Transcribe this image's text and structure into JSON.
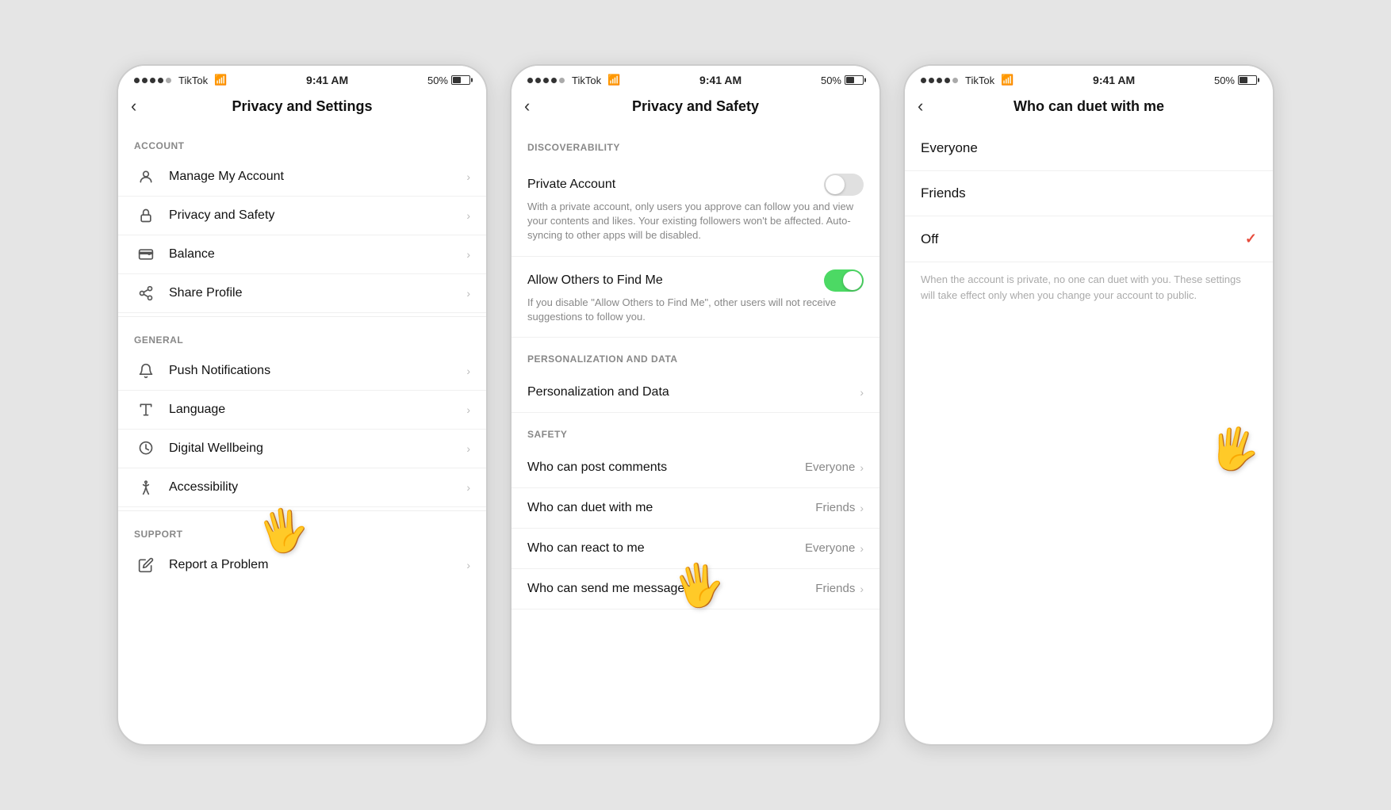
{
  "screens": [
    {
      "id": "privacy-settings",
      "statusBar": {
        "dots": [
          "full",
          "full",
          "full",
          "full",
          "full"
        ],
        "carrier": "TikTok",
        "wifi": true,
        "time": "9:41 AM",
        "battery": "50%"
      },
      "navTitle": "Privacy and Settings",
      "sections": [
        {
          "label": "ACCOUNT",
          "items": [
            {
              "icon": "person",
              "label": "Manage My Account",
              "chevron": true
            },
            {
              "icon": "lock",
              "label": "Privacy and Safety",
              "chevron": true
            },
            {
              "icon": "wallet",
              "label": "Balance",
              "chevron": true
            },
            {
              "icon": "share",
              "label": "Share Profile",
              "chevron": true
            }
          ]
        },
        {
          "label": "GENERAL",
          "items": [
            {
              "icon": "bell",
              "label": "Push Notifications",
              "chevron": true
            },
            {
              "icon": "font",
              "label": "Language",
              "chevron": true
            },
            {
              "icon": "wellbeing",
              "label": "Digital Wellbeing",
              "chevron": true
            },
            {
              "icon": "accessibility",
              "label": "Accessibility",
              "chevron": true
            }
          ]
        },
        {
          "label": "SUPPORT",
          "items": [
            {
              "icon": "pencil",
              "label": "Report a Problem",
              "chevron": true
            }
          ]
        }
      ],
      "cursor": {
        "bottom": "30%",
        "left": "48%"
      }
    },
    {
      "id": "privacy-safety",
      "statusBar": {
        "time": "9:41 AM",
        "battery": "50%"
      },
      "navTitle": "Privacy and Safety",
      "sections": [
        {
          "label": "DISCOVERABILITY",
          "items": [
            {
              "type": "toggle",
              "title": "Private Account",
              "desc": "With a private account, only users you approve can follow you and view your contents and likes. Your existing followers won't be affected. Auto-syncing to other apps will be disabled.",
              "state": "off"
            },
            {
              "type": "toggle",
              "title": "Allow Others to Find Me",
              "desc": "If you disable \"Allow Others to Find Me\", other users will not receive suggestions to follow you.",
              "state": "on"
            }
          ]
        },
        {
          "label": "PERSONALIZATION AND DATA",
          "items": [
            {
              "type": "chevron",
              "title": "Personalization and Data"
            }
          ]
        },
        {
          "label": "SAFETY",
          "items": [
            {
              "type": "chevron",
              "title": "Who can post comments",
              "value": "Everyone"
            },
            {
              "type": "chevron",
              "title": "Who can duet with me",
              "value": "Friends"
            },
            {
              "type": "chevron",
              "title": "Who can react to me",
              "value": "Everyone"
            },
            {
              "type": "chevron",
              "title": "Who can send me messages",
              "value": "Friends"
            }
          ]
        }
      ],
      "cursor": {
        "bottom": "22%",
        "left": "50%"
      }
    },
    {
      "id": "who-can-duet",
      "statusBar": {
        "time": "9:41 AM",
        "battery": "50%"
      },
      "navTitle": "Who can duet with me",
      "options": [
        {
          "label": "Everyone",
          "selected": false
        },
        {
          "label": "Friends",
          "selected": false
        },
        {
          "label": "Off",
          "selected": true
        }
      ],
      "note": "When the account is private, no one can duet with you. These settings will take effect only when you change your account to public.",
      "cursor": {
        "bottom": "42%",
        "right": "8%"
      }
    }
  ]
}
